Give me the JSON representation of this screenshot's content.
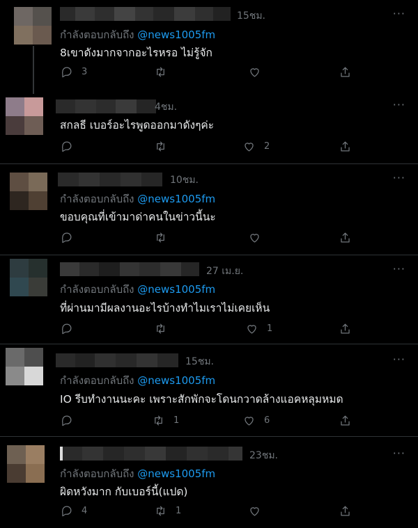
{
  "reply_prefix": "กำลังตอบกลับถึง",
  "handle": "@news1005fm",
  "more_label": "···",
  "tweets": [
    {
      "time": "15ชม.",
      "text": "8เขาดังมากจากอะไรหรอ ไม่รู้จัก",
      "replies": "3",
      "retweets": "",
      "likes": ""
    },
    {
      "time": "4ชม.",
      "text": "สกลธี เบอร์อะไรพูดออกมาดังๆค่ะ",
      "replies": "",
      "retweets": "",
      "likes": "2"
    },
    {
      "time": "10ชม.",
      "text": "ขอบคุณที่เข้ามาด่าคนในข่าวนี้นะ",
      "replies": "",
      "retweets": "",
      "likes": ""
    },
    {
      "time": "27 เม.ย.",
      "text": "ที่ผ่านมามีผลงานอะไรบ้างทำไมเราไม่เคยเห็น",
      "replies": "",
      "retweets": "",
      "likes": "1"
    },
    {
      "time": "15ชม.",
      "text": "IO รีบทำงานนะคะ เพราะสักพักจะโดนกวาดล้างแอคหลุมหมด",
      "replies": "",
      "retweets": "1",
      "likes": "6"
    },
    {
      "time": "23ชม.",
      "text": "ผิดหวังมาก กับเบอร์นี้(แปด)",
      "replies": "4",
      "retweets": "1",
      "likes": ""
    }
  ],
  "icons": [
    "reply-icon",
    "retweet-icon",
    "like-icon",
    "share-icon",
    "more-icon"
  ],
  "colors": {
    "background": "#000000",
    "text": "#e7e9ea",
    "muted": "#71767b",
    "link": "#1d9bf0",
    "divider": "#2f3336"
  }
}
